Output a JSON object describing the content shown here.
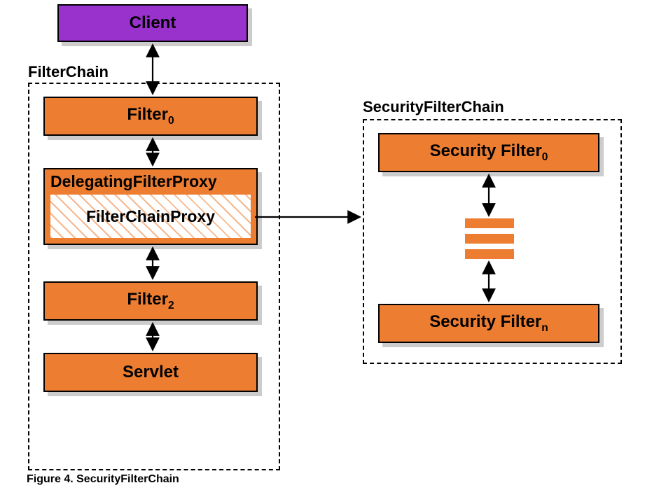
{
  "client": "Client",
  "filterChain": {
    "label": "FilterChain",
    "filter0": {
      "text": "Filter",
      "sub": "0"
    },
    "delegatingFilterProxy": "DelegatingFilterProxy",
    "filterChainProxy": "FilterChainProxy",
    "filter2": {
      "text": "Filter",
      "sub": "2"
    },
    "servlet": "Servlet"
  },
  "securityFilterChain": {
    "label": "SecurityFilterChain",
    "securityFilter0": {
      "text": "Security Filter",
      "sub": "0"
    },
    "securityFilterN": {
      "text": "Security Filter",
      "sub": "n"
    }
  },
  "caption": "Figure 4. SecurityFilterChain"
}
